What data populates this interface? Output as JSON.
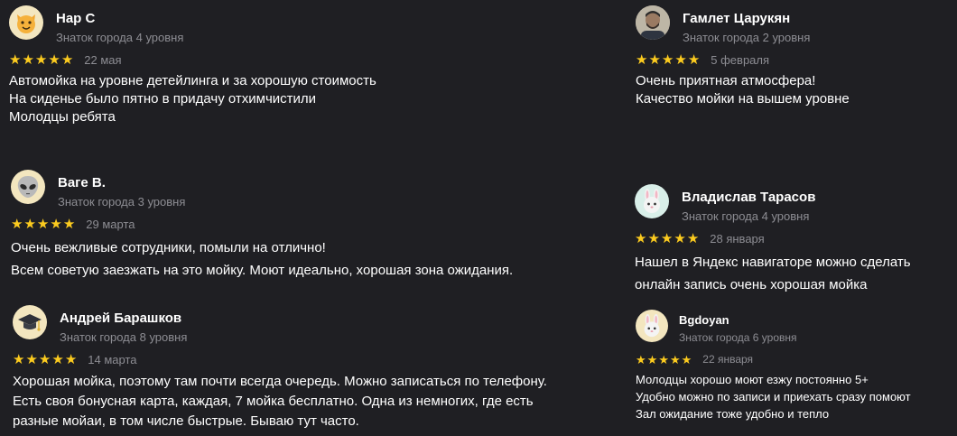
{
  "reviews": [
    {
      "author": "Нар С",
      "level": "Знаток города 4 уровня",
      "avatar_icon": "cat-face-icon",
      "rating": 5,
      "date": "22 мая",
      "lines": [
        "Автомойка на уровне детейлинга и за хорошую стоимость",
        "На сиденье было пятно в придачу отхимчистили",
        "Молодцы ребята"
      ]
    },
    {
      "author": "Гамлет Царукян",
      "level": "Знаток города 2 уровня",
      "avatar_icon": "user-photo-icon",
      "rating": 5,
      "date": "5 февраля",
      "lines": [
        "Очень приятная атмосфера!",
        "Качество мойки на вышем уровне"
      ]
    },
    {
      "author": "Ваге В.",
      "level": "Знаток города 3 уровня",
      "avatar_icon": "alien-face-icon",
      "rating": 5,
      "date": "29 марта",
      "lines": [
        "Очень вежливые сотрудники, помыли на отлично!",
        "Всем советую заезжать на это мойку. Моют идеально, хорошая зона ожидания."
      ]
    },
    {
      "author": "Владислав Тарасов",
      "level": "Знаток города 4 уровня",
      "avatar_icon": "rabbit-face-icon",
      "rating": 5,
      "date": "28 января",
      "lines": [
        "Нашел в Яндекс навигаторе можно сделать",
        "онлайн запись очень хорошая мойка"
      ]
    },
    {
      "author": "Андрей Барашков",
      "level": "Знаток города 8 уровня",
      "avatar_icon": "graduation-cap-icon",
      "rating": 5,
      "date": "14 марта",
      "lines": [
        "Хорошая мойка, поэтому там почти всегда очередь. Можно записаться по телефону.",
        "Есть своя бонусная карта, каждая, 7 мойка бесплатно. Одна из немногих, где есть",
        "разные мойаи, в том числе быстрые. Бываю тут часто."
      ]
    },
    {
      "author": "Bgdoyan",
      "level": "Знаток города 6 уровня",
      "avatar_icon": "rabbit-face-icon",
      "rating": 5,
      "date": "22 января",
      "lines": [
        "Молодцы хорошо моют езжу постоянно 5+",
        "Удобно можно по записи и приехать сразу помоют",
        "Зал ожидание тоже удобно и тепло"
      ]
    }
  ],
  "colors": {
    "background": "#1f1f23",
    "star": "#fccb1f",
    "secondary_text": "#8d8d93",
    "primary_text": "#ffffff"
  }
}
